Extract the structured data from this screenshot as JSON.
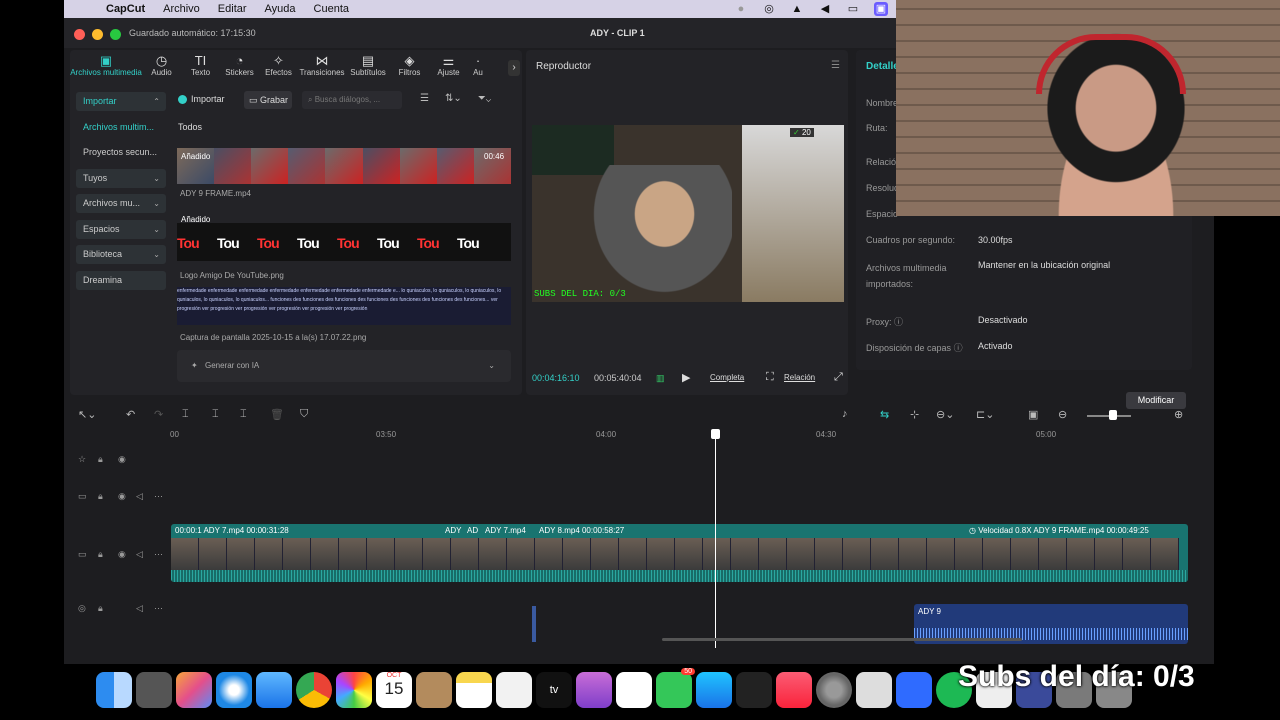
{
  "menubar": {
    "app": "CapCut",
    "items": [
      "Archivo",
      "Editar",
      "Ayuda",
      "Cuenta"
    ]
  },
  "window": {
    "autosave": "Guardado automático: 17:15:30",
    "title": "ADY - CLIP 1"
  },
  "toolbar": {
    "tools": [
      {
        "label": "Archivos multimedia",
        "icon": "media-icon"
      },
      {
        "label": "Audio",
        "icon": "audio-icon"
      },
      {
        "label": "Texto",
        "icon": "text-icon"
      },
      {
        "label": "Stickers",
        "icon": "sticker-icon"
      },
      {
        "label": "Efectos",
        "icon": "effects-icon"
      },
      {
        "label": "Transiciones",
        "icon": "transitions-icon"
      },
      {
        "label": "Subtítulos",
        "icon": "subtitles-icon"
      },
      {
        "label": "Filtros",
        "icon": "filters-icon"
      },
      {
        "label": "Ajuste",
        "icon": "adjust-icon"
      },
      {
        "label": "Au",
        "icon": "more-icon"
      }
    ]
  },
  "sidenav": {
    "items": [
      "Importar",
      "Archivos multim...",
      "Proyectos secun...",
      "Tuyos",
      "Archivos mu...",
      "Espacios",
      "Biblioteca",
      "Dreamina"
    ]
  },
  "media": {
    "import_label": "Importar",
    "record_label": "Grabar",
    "search_placeholder": "Busca diálogos, ...",
    "filter_label": "Todos",
    "clips": [
      {
        "tag": "Añadido",
        "duration": "00:46",
        "name": "ADY 9 FRAME.mp4"
      },
      {
        "tag": "Añadido",
        "name": "Logo Amigo De YouTube.png",
        "strip_text": "Tou"
      },
      {
        "name": "Captura de pantalla 2025-10-15 a la(s) 17.07.22.png",
        "strip_text": "enfermedade enfermedade enfermedade enfermedade enfermedade enfermedade enfermedade e... lo quniaculos, lo quniaculos, lo quniaculos, lo quniaculos, lo quniaculos, lo quniaculos... funciones des funciones des funciones des funciones des funciones des funciones des funciones... ver progresión ver progresión ver progresión ver progresión ver progresión ver progresión"
      }
    ],
    "generate_ai": "Generar con IA"
  },
  "player": {
    "title": "Reproductor",
    "current_time": "00:04:16:10",
    "total_time": "00:05:40:04",
    "complete_label": "Completa",
    "ratio_label": "Relación",
    "video_overlay": "SUBS DEL DIA: 0/3",
    "score_text": "20"
  },
  "details": {
    "title": "Detalle",
    "rows": [
      {
        "label": "Nombre",
        "value": ""
      },
      {
        "label": "Ruta:",
        "value": ""
      },
      {
        "label": "Relación",
        "value": ""
      },
      {
        "label": "Resolución",
        "value": ""
      },
      {
        "label": "Espacio",
        "value": ""
      },
      {
        "label": "Cuadros por segundo:",
        "value": "30.00fps"
      },
      {
        "label": "Archivos multimedia importados:",
        "value": "Mantener en la ubicación original"
      },
      {
        "label": "Proxy:",
        "value": "Desactivado"
      },
      {
        "label": "Disposición de capas",
        "value": "Activado"
      }
    ],
    "modify_label": "Modificar"
  },
  "timeline": {
    "ruler": [
      "00",
      "03:50",
      "04:00",
      "04:30",
      "05:00"
    ],
    "clip_labels": [
      "00:00:1 ADY 7.mp4  00:00:31:28",
      "ADY",
      "AD",
      "ADY 7.mp4",
      "ADY 8.mp4  00:00:58:27",
      "Velocidad 0.8X  ADY 9 FRAME.mp4  00:00:49:25"
    ],
    "audio_label": "ADY 9"
  },
  "dock": {
    "calendar_month": "OCT",
    "calendar_day": "15",
    "messages_badge": "50"
  },
  "overlay": {
    "subs_text": "Subs del día: 0/3"
  },
  "colors": {
    "accent": "#33d0c8",
    "main_track": "#197470",
    "audio_track": "#213a7a",
    "background": "#1d1d20"
  }
}
